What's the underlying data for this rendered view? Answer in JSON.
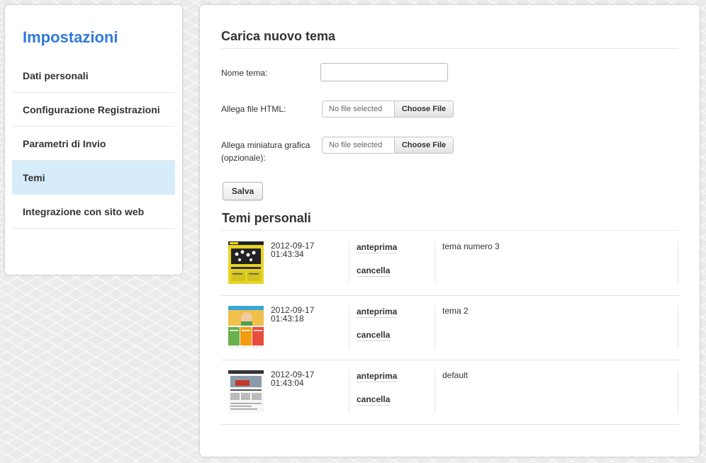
{
  "sidebar": {
    "title": "Impostazioni",
    "items": [
      {
        "label": "Dati personali"
      },
      {
        "label": "Configurazione Registrazioni"
      },
      {
        "label": "Parametri di Invio"
      },
      {
        "label": "Temi"
      },
      {
        "label": "Integrazione con sito web"
      }
    ],
    "active_index": 3
  },
  "upload": {
    "title": "Carica nuovo tema",
    "name_label": "Nome tema:",
    "name_value": "",
    "html_label": "Allega file HTML:",
    "thumb_label_line1": "Allega miniatura grafica",
    "thumb_label_line2": "(opzionale):",
    "no_file_text": "No file selected",
    "choose_file_label": "Choose File",
    "save_label": "Salva"
  },
  "themes": {
    "title": "Temi personali",
    "preview_label": "anteprima",
    "delete_label": "cancella",
    "rows": [
      {
        "date": "2012-09-17",
        "time": "01:43:34",
        "name": "tema numero 3",
        "thumb": "yellow-theme-thumbnail"
      },
      {
        "date": "2012-09-17",
        "time": "01:43:18",
        "name": "tema 2",
        "thumb": "kids-theme-thumbnail"
      },
      {
        "date": "2012-09-17",
        "time": "01:43:04",
        "name": "default",
        "thumb": "default-theme-thumbnail"
      }
    ]
  },
  "colors": {
    "accent": "#2f7ad8",
    "active_item_bg": "#d6ecfb"
  }
}
